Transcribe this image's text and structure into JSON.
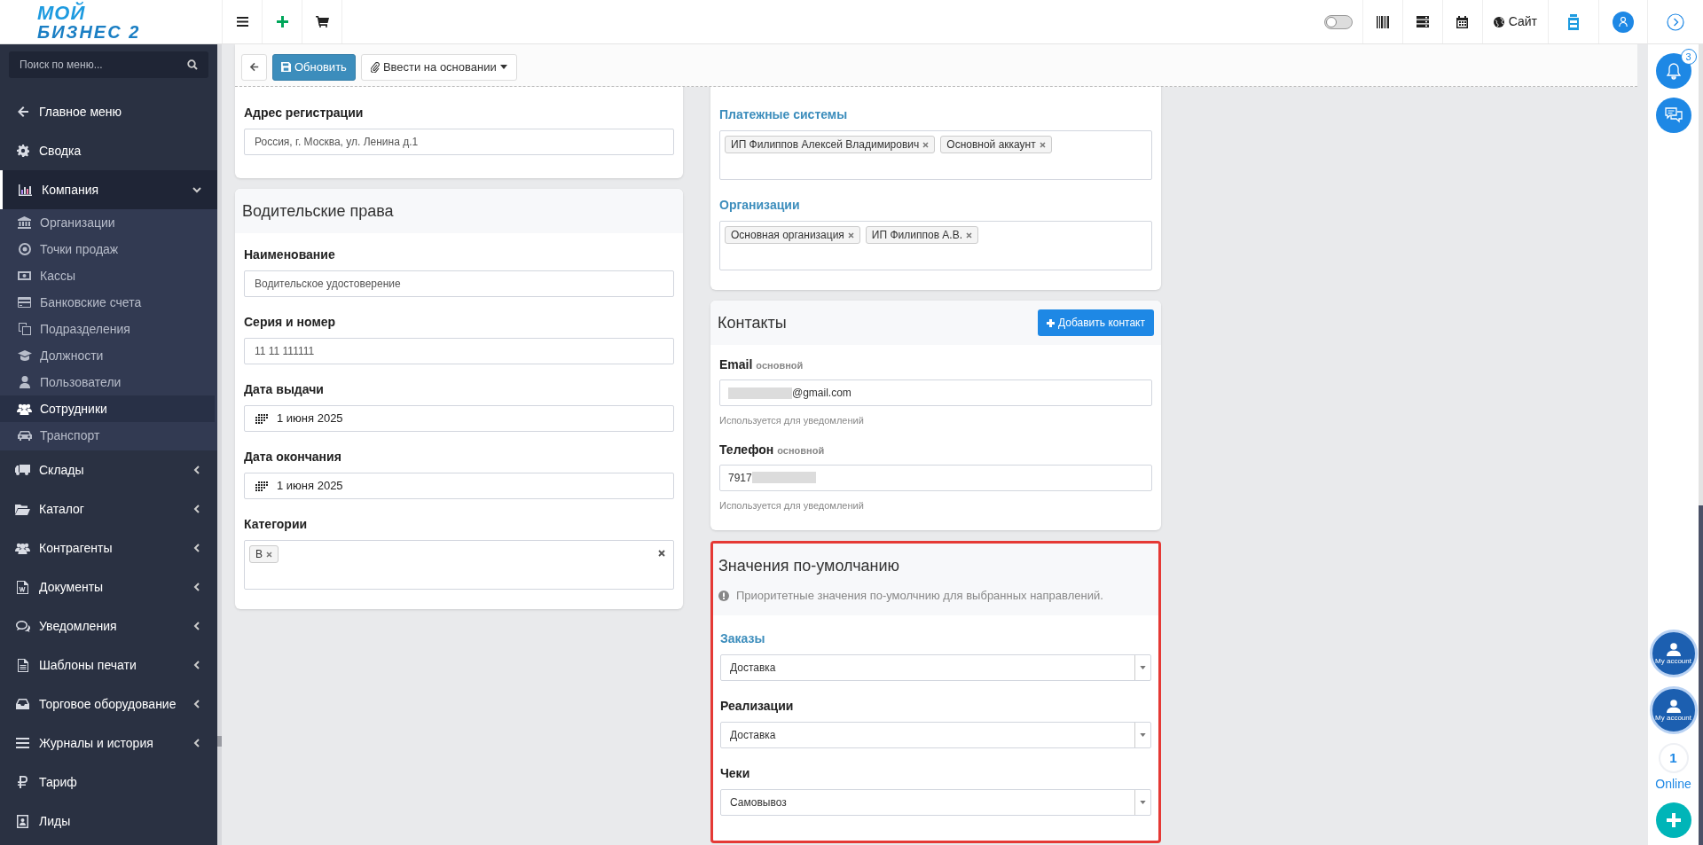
{
  "header": {
    "logo": {
      "line1": "МОЙ",
      "line2": "БИЗНЕС 2"
    },
    "theme_toggle": {
      "on": false
    },
    "site_link": "Сайт"
  },
  "sidebar": {
    "search": {
      "placeholder": "Поиск по меню..."
    },
    "items": [
      {
        "kind": "link",
        "label": "Главное меню"
      },
      {
        "kind": "link",
        "label": "Сводка"
      },
      {
        "kind": "group",
        "label": "Компания",
        "expanded": true,
        "children": [
          {
            "label": "Организации",
            "selected": false
          },
          {
            "label": "Точки продаж",
            "selected": false
          },
          {
            "label": "Кассы",
            "selected": false
          },
          {
            "label": "Банковские счета",
            "selected": false
          },
          {
            "label": "Подразделения",
            "selected": false
          },
          {
            "label": "Должности",
            "selected": false
          },
          {
            "label": "Пользователи",
            "selected": false
          },
          {
            "label": "Сотрудники",
            "selected": true
          },
          {
            "label": "Транспорт",
            "selected": false
          }
        ]
      },
      {
        "kind": "group",
        "label": "Склады",
        "expanded": false
      },
      {
        "kind": "group",
        "label": "Каталог",
        "expanded": false
      },
      {
        "kind": "group",
        "label": "Контрагенты",
        "expanded": false
      },
      {
        "kind": "group",
        "label": "Документы",
        "expanded": false
      },
      {
        "kind": "group",
        "label": "Уведомления",
        "expanded": false
      },
      {
        "kind": "group",
        "label": "Шаблоны печати",
        "expanded": false
      },
      {
        "kind": "group",
        "label": "Торговое оборудование",
        "expanded": false
      },
      {
        "kind": "group",
        "label": "Журналы и история",
        "expanded": false
      },
      {
        "kind": "link",
        "label": "Тариф"
      },
      {
        "kind": "link",
        "label": "Лиды"
      }
    ]
  },
  "toolbar": {
    "save_button": "Обновить",
    "based_on_button": "Ввести на основании"
  },
  "passport_card": {
    "fields": [
      {
        "kind": "text",
        "label": "Адрес регистрации",
        "linked": false,
        "value": "Россия, г. Москва, ул. Ленина д.1"
      }
    ]
  },
  "license_card": {
    "title": "Водительские права",
    "fields": [
      {
        "kind": "text",
        "label": "Наименование",
        "linked": false,
        "value": "Водительское удостоверение"
      },
      {
        "kind": "text",
        "label": "Серия и номер",
        "linked": false,
        "value": "11 11 111111"
      },
      {
        "kind": "date",
        "label": "Дата выдачи",
        "linked": false,
        "value": "1 июня 2025"
      },
      {
        "kind": "date",
        "label": "Дата окончания",
        "linked": false,
        "value": "1 июня 2025"
      },
      {
        "kind": "tags",
        "label": "Категории",
        "linked": false,
        "clearable": true,
        "tags": [
          "B"
        ]
      }
    ]
  },
  "links_card": {
    "fields": [
      {
        "kind": "tags",
        "label": "Платежные системы",
        "linked": true,
        "clearable": false,
        "tags": [
          "ИП Филиппов Алексей Владимирович",
          "Основной аккаунт"
        ]
      },
      {
        "kind": "tags",
        "label": "Организации",
        "linked": true,
        "clearable": false,
        "tags": [
          "Основная организация",
          "ИП Филиппов А.В."
        ]
      }
    ]
  },
  "contacts_card": {
    "title": "Контакты",
    "add_button": "Добавить контакт",
    "fields": [
      {
        "kind": "email",
        "label": "Email",
        "tag": "основной",
        "value": "@gmail.com",
        "hint": "Используется для уведомлений"
      },
      {
        "kind": "phone",
        "label": "Телефон",
        "tag": "основной",
        "value": "7917",
        "hint": "Используется для уведомлений"
      }
    ]
  },
  "defaults_card": {
    "title": "Значения по-умолчанию",
    "note": "Приоритетные значения по-умолчнию для выбранных направлений.",
    "highlighted": true,
    "fields": [
      {
        "kind": "select",
        "label": "Заказы",
        "linked": true,
        "value": "Доставка"
      },
      {
        "kind": "select",
        "label": "Реализации",
        "linked": false,
        "value": "Доставка"
      },
      {
        "kind": "select",
        "label": "Чеки",
        "linked": false,
        "value": "Самовывоз"
      }
    ]
  },
  "right_rail": {
    "notifications_badge": "3",
    "accounts": [
      "My account",
      "My account"
    ],
    "online_count": "1",
    "online_label": "Online"
  }
}
